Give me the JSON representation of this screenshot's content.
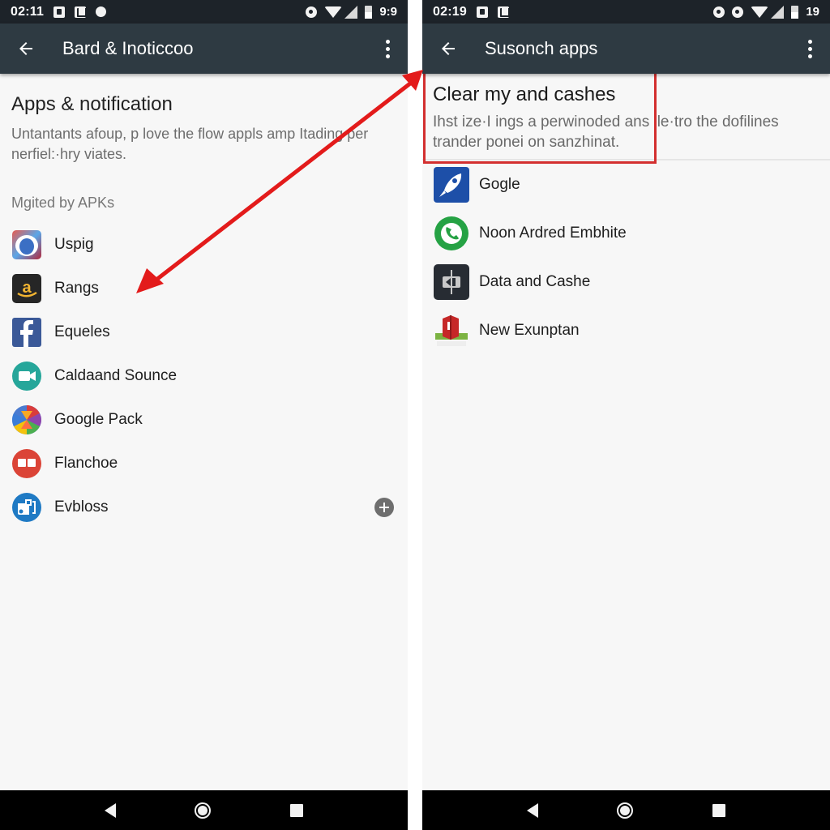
{
  "left_screen": {
    "status_bar": {
      "time": "02:11",
      "level": "9:9",
      "icons": [
        "notification-icon",
        "notification-icon",
        "dot-icon",
        "alarm-icon",
        "wifi-icon",
        "signal-icon",
        "battery-icon"
      ]
    },
    "app_bar": {
      "title": "Bard & Inoticcoo",
      "back_icon": "arrow-left-icon",
      "menu_icon": "more-vert-icon"
    },
    "section": {
      "title": "Apps & notification",
      "description": "Untantants afoup, p love the flow appls amp Itading per nerfiel:·hry viates.",
      "category": "Mgited by APKs"
    },
    "apps": [
      {
        "label": "Uspig",
        "icon": "eye-app-icon"
      },
      {
        "label": "Rangs",
        "icon": "amazon-icon"
      },
      {
        "label": "Equeles",
        "icon": "facebook-icon"
      },
      {
        "label": "Caldaand Sounce",
        "icon": "video-camera-icon"
      },
      {
        "label": "Google Pack",
        "icon": "colorful-pinwheel-icon"
      },
      {
        "label": "Flanchoe",
        "icon": "book-icon"
      },
      {
        "label": "Evbloss",
        "icon": "blue-circle-app-icon",
        "action": "add-icon"
      }
    ]
  },
  "right_screen": {
    "status_bar": {
      "time": "02:19",
      "level": "19",
      "icons": [
        "notification-icon",
        "notification-icon",
        "alarm-icon",
        "alarm-icon",
        "wifi-icon",
        "signal-icon",
        "battery-icon"
      ]
    },
    "app_bar": {
      "title": "Susonch apps",
      "back_icon": "arrow-left-icon",
      "menu_icon": "more-vert-icon"
    },
    "section": {
      "title": "Clear my and cashes",
      "description": "Ihst ize·I ings a perwinoded ans ile·tro the dofilines trander ponei on sanzhinat."
    },
    "apps": [
      {
        "label": "Gogle",
        "icon": "rocket-icon"
      },
      {
        "label": "Noon Ardred Embhite",
        "icon": "phone-green-icon"
      },
      {
        "label": "Data and Cashe",
        "icon": "storage-icon"
      },
      {
        "label": "New Exunptan",
        "icon": "red-box-icon"
      }
    ]
  },
  "annotation": {
    "color": "#e31b1b",
    "type": "double-headed-arrow"
  },
  "nav_bar": {
    "buttons": [
      "back",
      "home",
      "recents"
    ]
  },
  "colors": {
    "status_bar": "#1d2329",
    "app_bar": "#2e3a42",
    "background": "#f7f7f7",
    "highlight": "#d32f2f"
  }
}
